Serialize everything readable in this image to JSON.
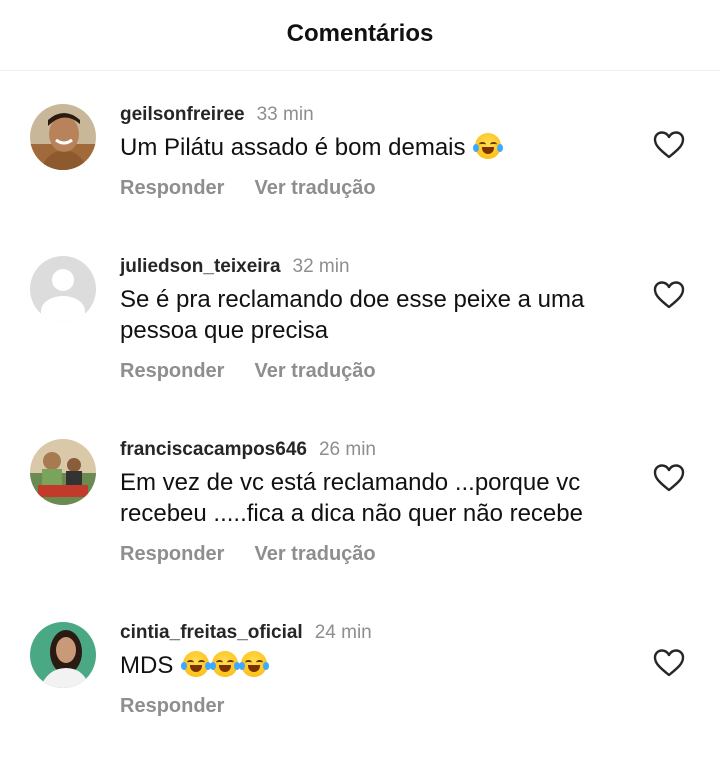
{
  "header": {
    "title": "Comentários"
  },
  "actions": {
    "reply_label": "Responder",
    "translate_label": "Ver tradução"
  },
  "comments": [
    {
      "username": "geilsonfreiree",
      "time": "33 min",
      "text": "Um Pilátu assado é bom demais",
      "emoji_count": 1,
      "show_translate": true
    },
    {
      "username": "juliedson_teixeira",
      "time": "32 min",
      "text": "Se é pra reclamando doe esse peixe a uma\npessoa que precisa",
      "emoji_count": 0,
      "show_translate": true
    },
    {
      "username": "franciscacampos646",
      "time": "26 min",
      "text": "Em vez de vc está reclamando ...porque vc\nrecebeu .....fica a dica não quer não recebe",
      "emoji_count": 0,
      "show_translate": true
    },
    {
      "username": "cintia_freitas_oficial",
      "time": "24 min",
      "text": "MDS",
      "emoji_count": 3,
      "show_translate": false
    }
  ]
}
